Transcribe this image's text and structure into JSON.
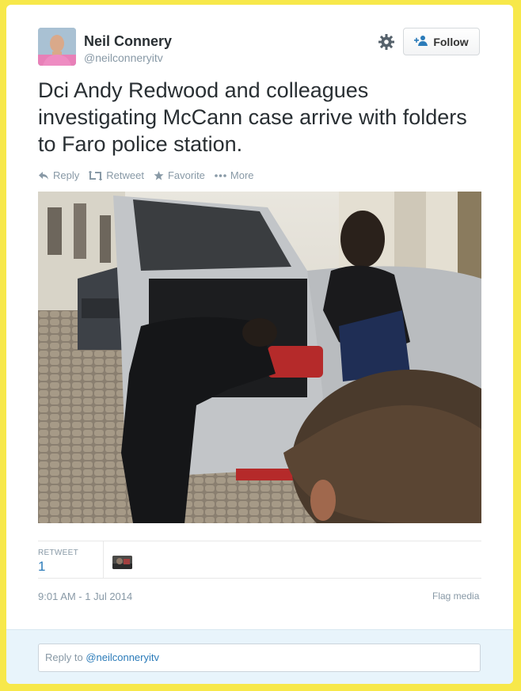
{
  "user": {
    "name": "Neil Connery",
    "handle": "@neilconneryitv"
  },
  "follow_label": "Follow",
  "tweet": {
    "text": "Dci Andy Redwood and colleagues investigating McCann case arrive with folders to Faro police station."
  },
  "actions": [
    {
      "label": "Reply",
      "icon": "reply-icon"
    },
    {
      "label": "Retweet",
      "icon": "retweet-icon"
    },
    {
      "label": "Favorite",
      "icon": "star-icon"
    },
    {
      "label": "More",
      "icon": "more-icon"
    }
  ],
  "stats": {
    "retweet_label": "RETWEET",
    "retweet_count": "1"
  },
  "timestamp": "9:01 AM - 1 Jul 2014",
  "flag_label": "Flag media",
  "reply": {
    "prefix": "Reply to ",
    "mention": "@neilconneryitv"
  },
  "colors": {
    "background": "#f7e84a",
    "link": "#2b7bb9",
    "muted": "#8899a6",
    "text": "#292f33"
  }
}
